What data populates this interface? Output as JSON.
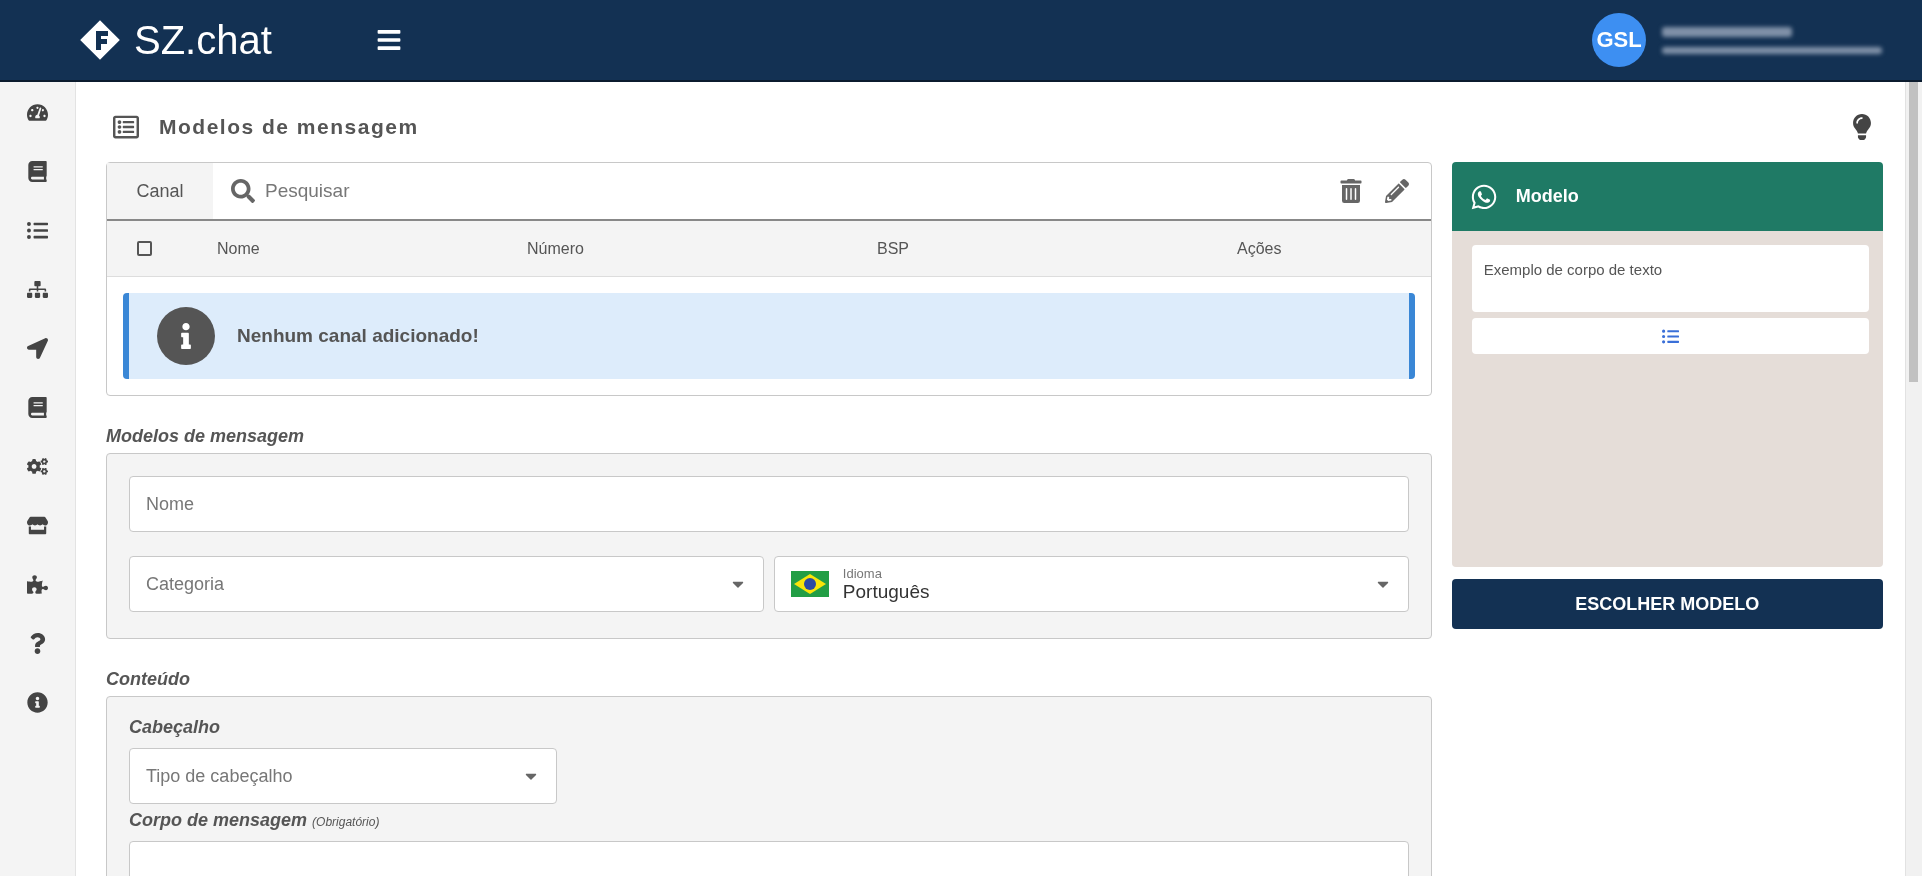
{
  "topbar": {
    "logo": "SZ.chat",
    "avatar": "GSL"
  },
  "page": {
    "title": "Modelos de mensagem"
  },
  "channels": {
    "tab": "Canal",
    "search": {
      "placeholder": "Pesquisar"
    },
    "select_all": {
      "checked": false
    },
    "columns": [
      "Nome",
      "Número",
      "BSP",
      "Ações"
    ],
    "empty": "Nenhum canal adicionado!"
  },
  "template_section": {
    "label": "Modelos de mensagem",
    "name": {
      "placeholder": "Nome"
    },
    "category": {
      "placeholder": "Categoria"
    },
    "language": {
      "label": "Idioma",
      "value": "Português"
    }
  },
  "content_section": {
    "label": "Conteúdo",
    "header": {
      "label": "Cabeçalho",
      "placeholder": "Tipo de cabeçalho"
    },
    "body": {
      "label": "Corpo de mensagem",
      "note": "(Obrigatório)"
    }
  },
  "preview": {
    "title": "Modelo",
    "message": "Exemplo de corpo de texto",
    "button": "ESCOLHER MODELO"
  }
}
